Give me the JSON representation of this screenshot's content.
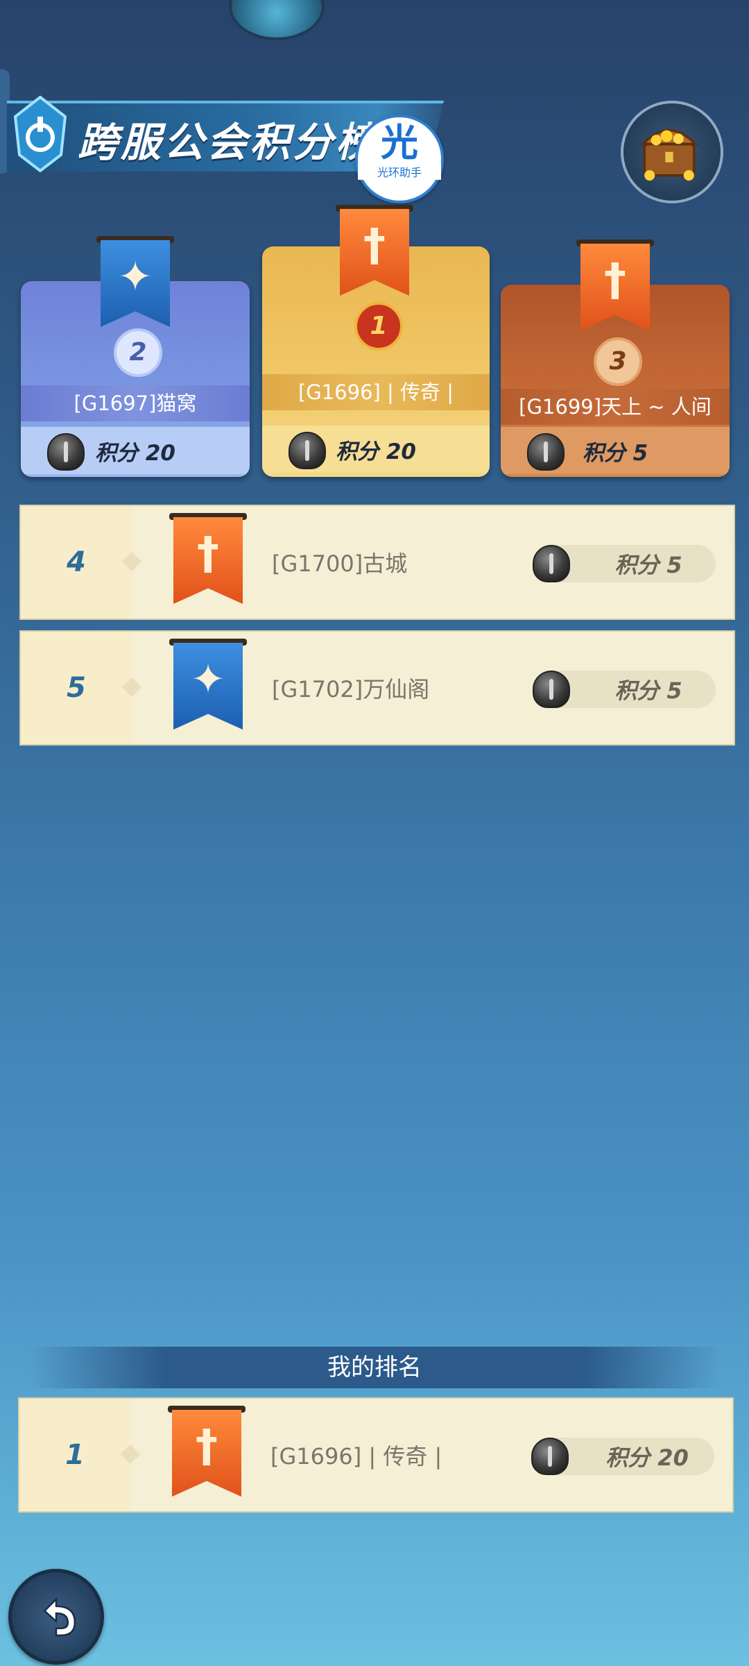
{
  "title": "跨服公会积分榜",
  "helper_badge": {
    "main": "光",
    "sub": "光环助手"
  },
  "podium": [
    {
      "rank": "2",
      "name": "[G1697]猫窝",
      "score": "积分 20",
      "flag": "blue"
    },
    {
      "rank": "1",
      "name": "[G1696] | 传奇 |",
      "score": "积分 20",
      "flag": "orange"
    },
    {
      "rank": "3",
      "name": "[G1699]天上 ~ 人间",
      "score": "积分 5",
      "flag": "orange"
    }
  ],
  "list": [
    {
      "rank": "4",
      "name": "[G1700]古城",
      "score": "积分 5",
      "flag": "orange"
    },
    {
      "rank": "5",
      "name": "[G1702]万仙阁",
      "score": "积分 5",
      "flag": "blue"
    }
  ],
  "my_rank": {
    "label": "我的排名",
    "rank": "1",
    "name": "[G1696] | 传奇 |",
    "score": "积分 20",
    "flag": "orange"
  },
  "icons": {
    "title_emblem": "guild-emblem-icon",
    "chest": "treasure-chest-icon",
    "helmet": "helmet-icon",
    "back": "back-arrow-icon"
  }
}
